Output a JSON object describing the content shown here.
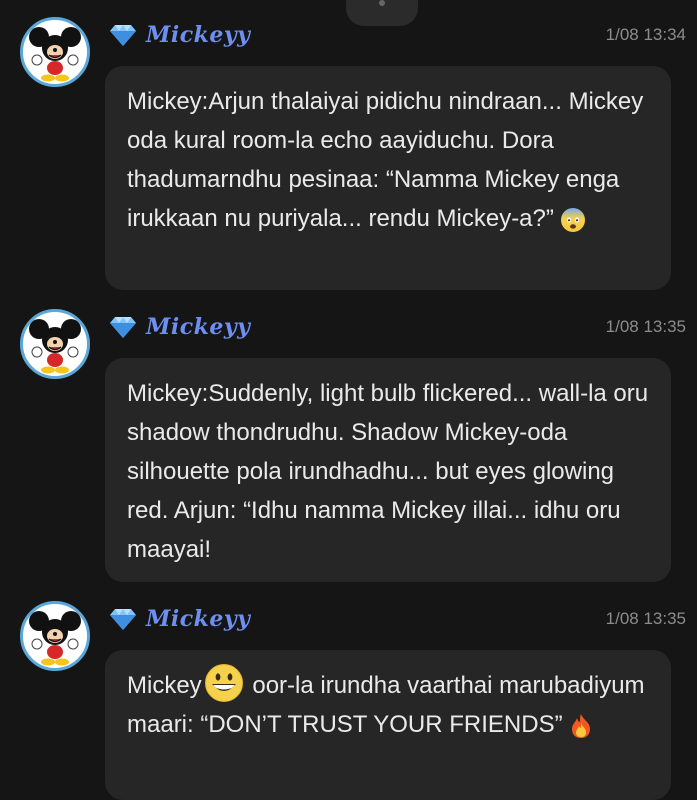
{
  "messages": [
    {
      "username": "Mickeyy",
      "time": "1/08 13:34",
      "text": "Mickey:Arjun thalaiyai pidichu nindraan... Mickey oda kural room-la echo aayiduchu. Dora thadumarndhu pesinaa: “Namma Mickey enga irukkaan nu puriyala... rendu Mickey-a?”",
      "emoji": "fearful-face-emoji"
    },
    {
      "username": "Mickeyy",
      "time": "1/08 13:35",
      "text": "Mickey:Suddenly, light bulb flickered... wall-la oru shadow thondrudhu. Shadow Mickey-oda silhouette pola irundhadhu... but eyes glowing red. Arjun: “Idhu namma Mickey illai... idhu oru maayai!"
    },
    {
      "username": "Mickeyy",
      "time": "1/08 13:35",
      "text_before": "Mickey",
      "inline_emoji": "grinning-face-emoji",
      "text_after": " oor-la irundha vaarthai marubadiyum maari: “DON’T TRUST YOUR FRIENDS”",
      "emoji": "fire-emoji"
    }
  ],
  "colors": {
    "background": "#151515",
    "bubble": "#262626",
    "username": "#6e8ff0",
    "timestamp": "#8c8c8c",
    "avatar_border": "#5aa7d8"
  }
}
